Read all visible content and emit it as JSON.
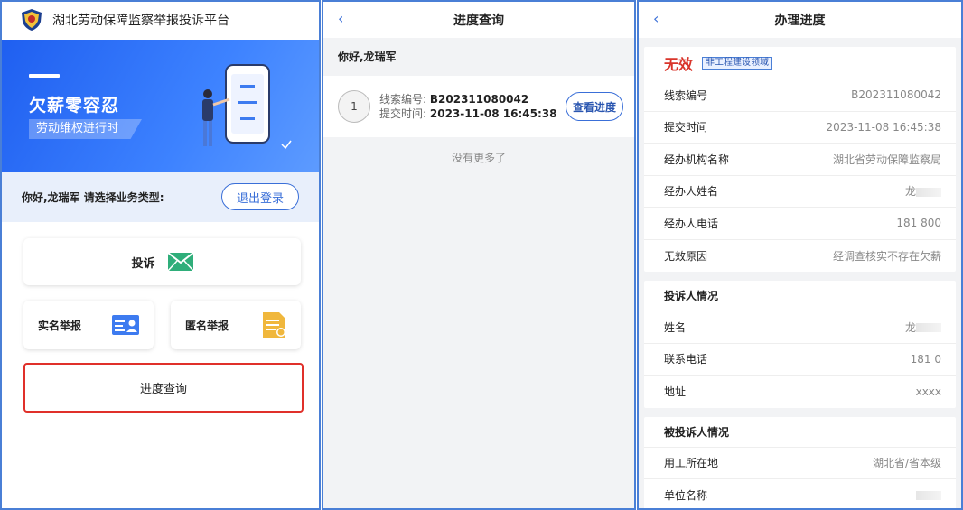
{
  "left": {
    "header_title": "湖北劳动保障监察举报投诉平台",
    "banner": {
      "title": "欠薪零容忍",
      "tag": "劳动维权进行时"
    },
    "greeting": "你好,龙瑞军 请选择业务类型:",
    "logout_label": "退出登录",
    "complaint_label": "投诉",
    "real_name_label": "实名举报",
    "anon_label": "匿名举报",
    "progress_label": "进度查询",
    "accent": "#3a6fd8",
    "highlight": "#e0302a"
  },
  "middle": {
    "nav_title": "进度查询",
    "greeting": "你好,龙瑞军",
    "record": {
      "index": "1",
      "clue_key": "线索编号:",
      "clue_value": "B202311080042",
      "submit_key": "提交时间:",
      "submit_value": "2023-11-08 16:45:38",
      "button_label": "查看进度"
    },
    "no_more": "没有更多了"
  },
  "right": {
    "nav_title": "办理进度",
    "status": "无效",
    "status_tag": "非工程建设领域",
    "status_color": "#d9352b",
    "details": [
      {
        "k": "线索编号",
        "v": "B202311080042"
      },
      {
        "k": "提交时间",
        "v": "2023-11-08 16:45:38"
      },
      {
        "k": "经办机构名称",
        "v": "湖北省劳动保障监察局"
      },
      {
        "k": "经办人姓名",
        "v": "龙"
      },
      {
        "k": "经办人电话",
        "v": "181 800"
      },
      {
        "k": "无效原因",
        "v": "经调查核实不存在欠薪"
      }
    ],
    "complainant": {
      "title": "投诉人情况",
      "rows": [
        {
          "k": "姓名",
          "v": "龙"
        },
        {
          "k": "联系电话",
          "v": "181 0"
        },
        {
          "k": "地址",
          "v": "xxxx"
        }
      ]
    },
    "respondent": {
      "title": "被投诉人情况",
      "rows": [
        {
          "k": "用工所在地",
          "v": "湖北省/省本级"
        },
        {
          "k": "单位名称",
          "v": ""
        }
      ]
    }
  }
}
